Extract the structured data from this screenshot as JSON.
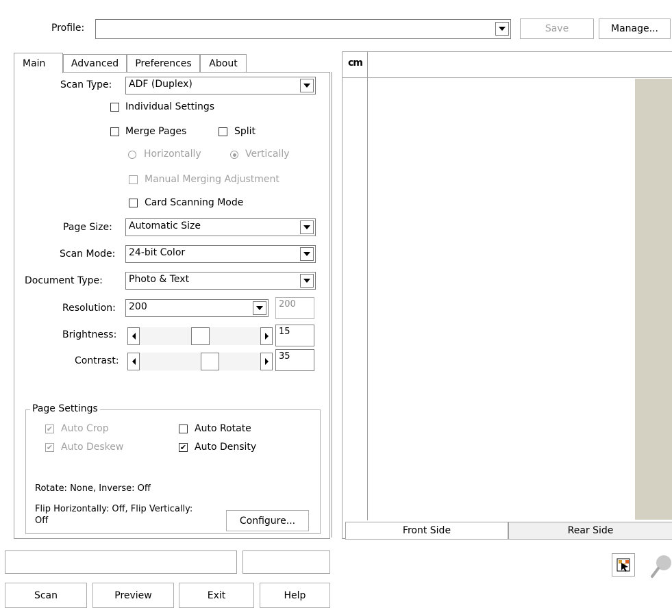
{
  "profile": {
    "label": "Profile:",
    "value": "",
    "save_label": "Save",
    "manage_label": "Manage..."
  },
  "tabs": [
    {
      "label": "Main",
      "active": true
    },
    {
      "label": "Advanced",
      "active": false
    },
    {
      "label": "Preferences",
      "active": false
    },
    {
      "label": "About",
      "active": false
    }
  ],
  "main": {
    "scan_type": {
      "label": "Scan Type:",
      "value": "ADF (Duplex)"
    },
    "individual_settings": {
      "label": "Individual Settings",
      "checked": false
    },
    "merge_pages": {
      "label": "Merge Pages",
      "checked": false
    },
    "split": {
      "label": "Split",
      "checked": false
    },
    "horizontally": {
      "label": "Horizontally",
      "selected": false
    },
    "vertically": {
      "label": "Vertically",
      "selected": true
    },
    "manual_merging": {
      "label": "Manual Merging Adjustment",
      "checked": false
    },
    "card_scanning": {
      "label": "Card Scanning Mode",
      "checked": false
    },
    "page_size": {
      "label": "Page Size:",
      "value": "Automatic Size"
    },
    "scan_mode": {
      "label": "Scan Mode:",
      "value": "24-bit Color"
    },
    "document_type": {
      "label": "Document Type:",
      "value": "Photo & Text"
    },
    "resolution": {
      "label": "Resolution:",
      "value": "200",
      "box": "200"
    },
    "brightness": {
      "label": "Brightness:",
      "value": "15",
      "fraction": 0.5
    },
    "contrast": {
      "label": "Contrast:",
      "value": "35",
      "fraction": 0.6
    }
  },
  "page_settings": {
    "title": "Page Settings",
    "auto_crop": {
      "label": "Auto Crop",
      "checked": true
    },
    "auto_deskew": {
      "label": "Auto Deskew",
      "checked": true
    },
    "auto_rotate": {
      "label": "Auto Rotate",
      "checked": false
    },
    "auto_density": {
      "label": "Auto Density",
      "checked": true
    },
    "rotate_info": "Rotate: None, Inverse: Off",
    "flip_info_1": "Flip Horizontally: Off, Flip Vertically:",
    "flip_info_2": "Off",
    "configure_label": "Configure..."
  },
  "preview": {
    "ruler_unit": "cm",
    "front_tab": "Front Side",
    "rear_tab": "Rear Side"
  },
  "status": {
    "left": "",
    "right": ""
  },
  "buttons": {
    "scan": "Scan",
    "preview": "Preview",
    "exit": "Exit",
    "help": "Help"
  },
  "icons": {
    "image_tool": "image-select-icon",
    "zoom": "magnifier-icon"
  },
  "colors": {
    "side_strip": "#d4d0c2",
    "check_mark": "#000000"
  }
}
